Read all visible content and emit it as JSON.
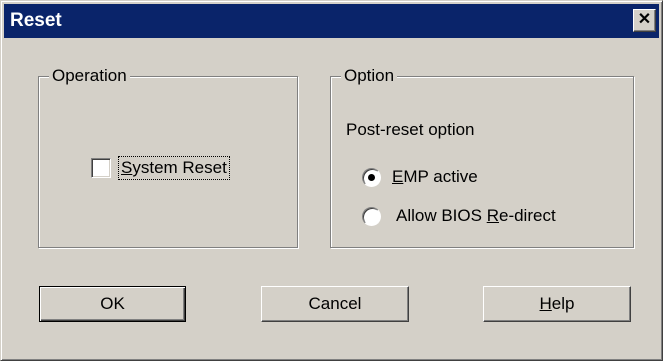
{
  "window": {
    "title": "Reset",
    "close_glyph": "✕"
  },
  "operation": {
    "group_label": "Operation",
    "system_reset": {
      "label": "System Reset",
      "checked": false
    }
  },
  "option": {
    "group_label": "Option",
    "heading": "Post-reset option",
    "radios": [
      {
        "label": "EMP active",
        "selected": true
      },
      {
        "label": "Allow BIOS Re-direct",
        "selected": false
      }
    ]
  },
  "buttons": {
    "ok": "OK",
    "cancel": "Cancel",
    "help": "Help"
  },
  "colors": {
    "title_bar": "#0a246a",
    "face": "#d4d0c8"
  },
  "icons": {
    "close": "close-icon"
  }
}
